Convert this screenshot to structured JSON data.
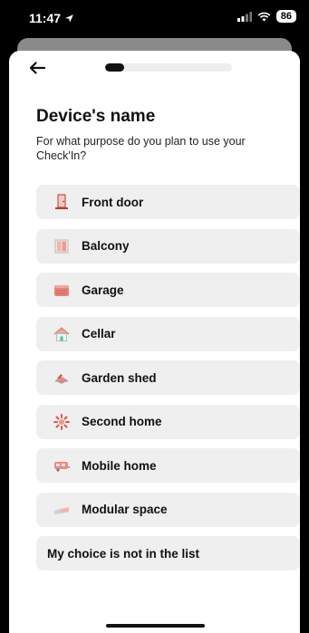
{
  "status": {
    "time": "11:47",
    "battery": "86"
  },
  "header": {
    "progress_fraction": 0.15
  },
  "page": {
    "title": "Device's name",
    "subtitle": "For what purpose do you plan to use your Check'In?"
  },
  "options": [
    {
      "label": "Front door",
      "icon": "front-door-icon"
    },
    {
      "label": "Balcony",
      "icon": "balcony-icon"
    },
    {
      "label": "Garage",
      "icon": "garage-icon"
    },
    {
      "label": "Cellar",
      "icon": "cellar-icon"
    },
    {
      "label": "Garden shed",
      "icon": "garden-shed-icon"
    },
    {
      "label": "Second home",
      "icon": "second-home-icon"
    },
    {
      "label": "Mobile home",
      "icon": "mobile-home-icon"
    },
    {
      "label": "Modular space",
      "icon": "modular-space-icon"
    },
    {
      "label": "My choice is not in the list",
      "icon": ""
    }
  ]
}
